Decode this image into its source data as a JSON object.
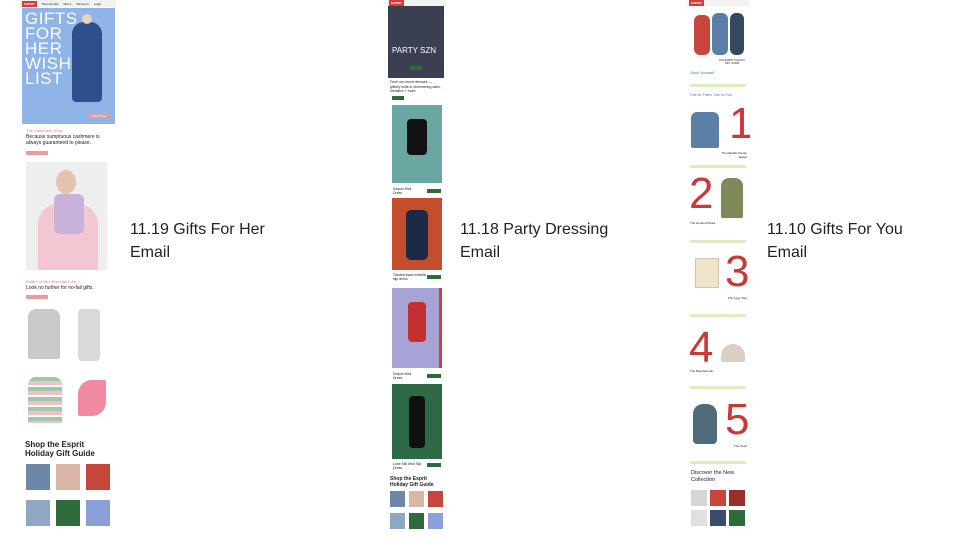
{
  "captions": {
    "email1": {
      "line1": "11.19 Gifts For Her",
      "line2": "Email"
    },
    "email2": {
      "line1": "11.18 Party Dressing",
      "line2": "Email"
    },
    "email3": {
      "line1": "11.10 Gifts For You",
      "line2": "Email"
    }
  },
  "email1": {
    "logo": "ESPRIT",
    "nav": [
      "New Arrivals",
      "Men's",
      "Women's",
      "Login"
    ],
    "hero_title": [
      "GIFTS",
      "FOR",
      "HER",
      "WISH",
      "LIST"
    ],
    "hero_button": "Shop Now",
    "cashmere_eyebrow": "The Cashmere Shop",
    "cashmere_heading": "Because sumptuous cashmere is always guaranteed to please.",
    "cashmere_button": "Shop Now",
    "knit_eyebrow": "Knits For Her Who Has It All",
    "knit_heading": "Look no further for no-fail gifts.",
    "knit_button": "Shop Now",
    "guide_heading": "Shop the Esprit Holiday Gift Guide"
  },
  "email2": {
    "logo": "ESPRIT",
    "hero_title": "PARTY SZN",
    "hero_button": "Shop Now",
    "intro": "From our resort dresses — glittery knits to shimmering satin, metallics + more",
    "guide_heading": "Shop the Esprit Holiday Gift Guide",
    "products": [
      "Sequin Mini Dress",
      "Twisted-back metallic slip dress",
      "Sequin Mini Dress",
      "Luxe Silk Midi Slip Dress"
    ]
  },
  "email3": {
    "logo": "ESPRIT",
    "hero_label": "THE ESPRIT HOLIDAY GIFT GUIDE",
    "spoil_heading": "Spoil Yourself",
    "one_for_them": "One for Them, Two for You",
    "numbers": [
      "1",
      "2",
      "3",
      "4",
      "5"
    ],
    "items": [
      "The Metallic Denim Jacket",
      "The Hooded Parka",
      "The Logo Tote",
      "The Baseball Hat",
      "The Scarf"
    ],
    "discover": "Discover the New Collection"
  },
  "colors": {
    "brand_red": "#d43b3b",
    "pink_button": "#e79aa0",
    "green_button": "#2f6b3a",
    "light_green_bar": "#dfeec2",
    "hero_blue": "#8fb4e8"
  }
}
